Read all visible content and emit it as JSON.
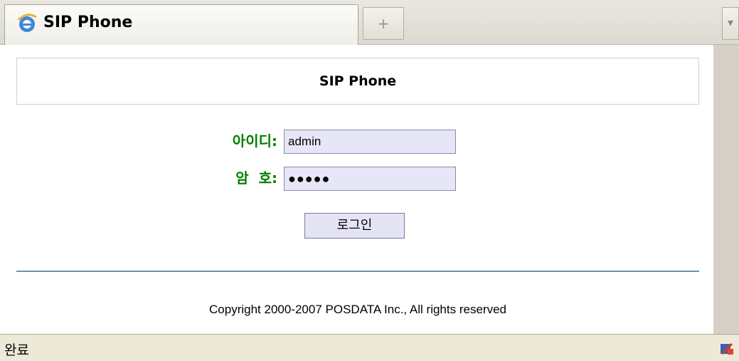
{
  "tab": {
    "title": "SIP Phone",
    "new_tab_symbol": "+",
    "list_symbol": "▾",
    "icon": "ie-icon"
  },
  "page": {
    "header": "SIP Phone",
    "id_label": "아이디:",
    "id_value": "admin",
    "pw_label": "암  호:",
    "pw_value": "●●●●●",
    "login_button": "로그인",
    "copyright": "Copyright 2000-2007 POSDATA Inc., All rights reserved"
  },
  "status": {
    "text": "완료",
    "icon": "page-status-icon"
  },
  "colors": {
    "label_green": "#007f00",
    "field_bg": "#e6e6f8",
    "divider_blue": "#6f8fb4"
  }
}
